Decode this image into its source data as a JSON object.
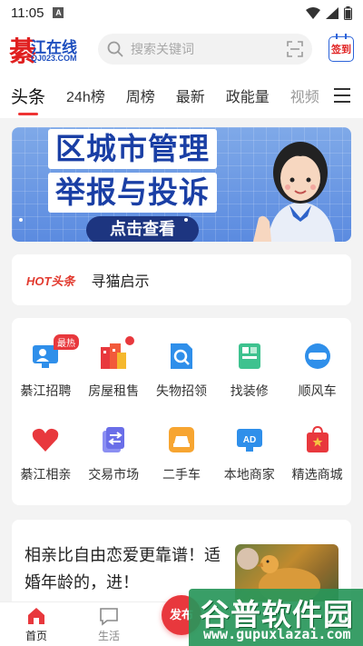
{
  "status_bar": {
    "time": "11:05",
    "notif_letter": "A"
  },
  "header": {
    "logo_char": "綦",
    "logo_name": "江在线",
    "logo_url": "QJ023.COM",
    "search_placeholder": "搜索关键词",
    "signin_label": "签到"
  },
  "tabs": [
    "头条",
    "24h榜",
    "周榜",
    "最新",
    "政能量",
    "视频"
  ],
  "banner": {
    "line1": "区城市管理",
    "line2": "举报与投诉",
    "button": "点击查看"
  },
  "hot": {
    "badge": "HOT头条",
    "text": "寻猫启示"
  },
  "services": [
    {
      "label": "綦江招聘",
      "icon": "recruit-icon",
      "tag": "最热"
    },
    {
      "label": "房屋租售",
      "icon": "house-icon",
      "dot": true
    },
    {
      "label": "失物招领",
      "icon": "lost-found-icon"
    },
    {
      "label": "找装修",
      "icon": "renovation-icon"
    },
    {
      "label": "顺风车",
      "icon": "carpool-icon"
    },
    {
      "label": "綦江相亲",
      "icon": "heart-icon"
    },
    {
      "label": "交易市场",
      "icon": "exchange-icon"
    },
    {
      "label": "二手车",
      "icon": "used-car-icon"
    },
    {
      "label": "本地商家",
      "icon": "ad-icon"
    },
    {
      "label": "精选商城",
      "icon": "shop-bag-icon"
    }
  ],
  "article": {
    "title": "相亲比自由恋爱更靠谱！适婚年龄的，进！"
  },
  "bottom_nav": {
    "home": "首页",
    "life": "生活",
    "publish": "发布"
  },
  "watermark": {
    "title": "谷普软件园",
    "url": "www.gupuxlazai.com"
  },
  "colors": {
    "accent": "#e8383d",
    "brand_blue": "#1e4fbf"
  }
}
